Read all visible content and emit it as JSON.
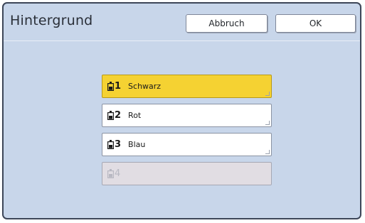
{
  "dialog": {
    "title": "Hintergrund",
    "cancel_label": "Abbruch",
    "ok_label": "OK"
  },
  "options": [
    {
      "num": "1",
      "label": "Schwarz",
      "state": "selected",
      "icon": "ink-cartridge-icon"
    },
    {
      "num": "2",
      "label": "Rot",
      "state": "normal",
      "icon": "ink-cartridge-icon"
    },
    {
      "num": "3",
      "label": "Blau",
      "state": "normal",
      "icon": "ink-cartridge-icon"
    },
    {
      "num": "4",
      "label": "",
      "state": "disabled",
      "icon": "ink-cartridge-icon"
    }
  ],
  "colors": {
    "background": "#c8d6ea",
    "selected": "#f5d232",
    "disabled": "#e1dde3",
    "border": "#3d4658"
  }
}
